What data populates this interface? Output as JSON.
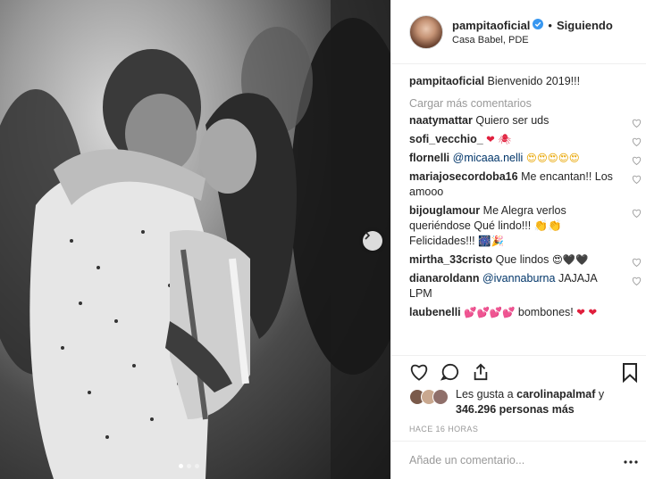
{
  "header": {
    "username": "pampitaoficial",
    "verified_icon": "verified-badge-icon",
    "separator": "•",
    "follow_status": "Siguiendo",
    "location": "Casa Babel, PDE"
  },
  "caption": {
    "username": "pampitaoficial",
    "text": "Bienvenido 2019!!!"
  },
  "load_more": "Cargar más comentarios",
  "comments": [
    {
      "username": "naatymattar",
      "text": "Quiero ser uds",
      "emoji": ""
    },
    {
      "username": "sofi_vecchio_",
      "text": "",
      "emoji": "❤ 🕷"
    },
    {
      "username": "flornelli",
      "mention": "@micaaa.nelli",
      "text": "",
      "emoji": "😍😍😍😍😍"
    },
    {
      "username": "mariajosecordoba16",
      "text": "Me encantan!! Los amooo",
      "emoji": ""
    },
    {
      "username": "bijouglamour",
      "text": "Me Alegra verlos queriéndose Qué lindo!!! 👏👏 Felicidades!!!",
      "emoji": "🎆🎉"
    },
    {
      "username": "mirtha_33cristo",
      "text": "Que lindos",
      "emoji": "😍🖤🖤"
    },
    {
      "username": "dianaroldann",
      "mention": "@ivannaburna",
      "text": "JAJAJA LPM",
      "emoji": ""
    },
    {
      "username": "laubenelli",
      "text": "bombones!",
      "emoji_before": "💕💕💕💕",
      "emoji": "❤ ❤"
    }
  ],
  "likes": {
    "prefix": "Les gusta a",
    "user": "carolinapalmaf",
    "joiner": "y",
    "count": "346.296 personas más"
  },
  "timestamp": "HACE 16 HORAS",
  "add_comment": {
    "placeholder": "Añade un comentario..."
  },
  "colors": {
    "mention": "#003569",
    "muted": "#999999",
    "border": "#efefef",
    "verified": "#3897f0"
  },
  "carousel": {
    "dot_count": 3,
    "active_dot": 1
  }
}
